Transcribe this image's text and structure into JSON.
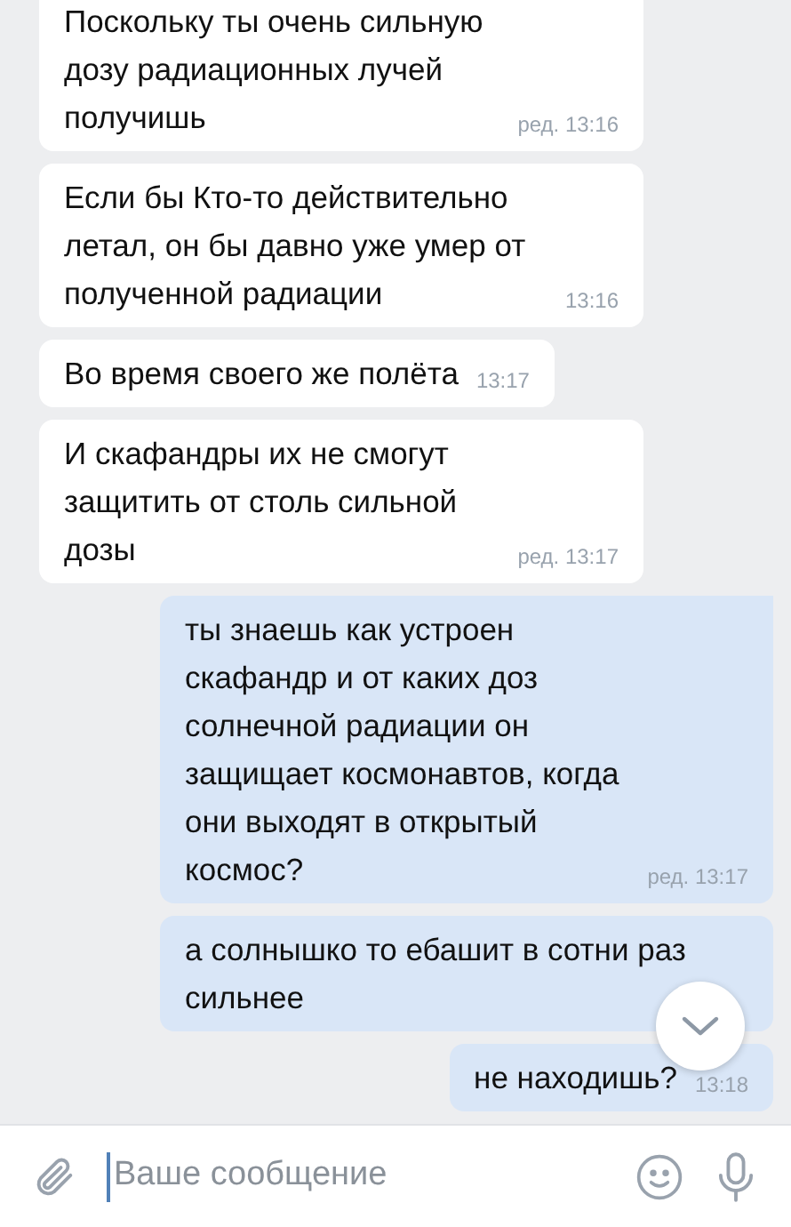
{
  "messages": [
    {
      "outgoing": false,
      "text": "Поскольку ты очень сильную дозу радиационных лучей получишь",
      "time": "ред. 13:16"
    },
    {
      "outgoing": false,
      "text": "Если бы Кто-то действительно летал, он бы давно уже умер от полученной радиации",
      "time": "13:16"
    },
    {
      "outgoing": false,
      "text": "Во время своего же полёта",
      "time": "13:17"
    },
    {
      "outgoing": false,
      "text": "И скафандры их не смогут защитить от столь сильной дозы",
      "time": "ред. 13:17"
    },
    {
      "outgoing": true,
      "text": "ты знаешь как устроен скафандр и от каких доз солнечной радиации он  защищает космонавтов, когда они выходят в открытый космос?",
      "time": "ред. 13:17",
      "tail": true
    },
    {
      "outgoing": true,
      "text": "а солнышко то ебашит в сотни раз сильнее"
    },
    {
      "outgoing": true,
      "text": "не находишь?",
      "time": "13:18"
    }
  ],
  "composer": {
    "placeholder": "Ваше сообщение"
  }
}
